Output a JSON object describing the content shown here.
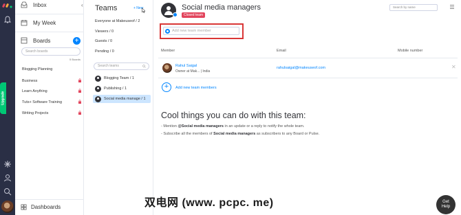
{
  "sidebar": {
    "inbox_label": "Inbox",
    "my_week_label": "My Week",
    "boards_label": "Boards",
    "boards_search_placeholder": "Search boards",
    "boards_count": "5 Boards",
    "boards": [
      {
        "label": "Blogging Planning",
        "locked": false
      },
      {
        "label": "Business",
        "locked": true
      },
      {
        "label": "Learn Anything",
        "locked": true
      },
      {
        "label": "Tuts+ Software Training",
        "locked": true
      },
      {
        "label": "Writing Projects",
        "locked": true
      }
    ],
    "dashboards_label": "Dashboards",
    "upgrade_label": "Upgrade"
  },
  "teams": {
    "title": "Teams",
    "new_label": "+ New",
    "filters": [
      {
        "label": "Everyone at Makeuseof / 2"
      },
      {
        "label": "Viewers / 0"
      },
      {
        "label": "Guests / 0"
      },
      {
        "label": "Pending / 0"
      }
    ],
    "search_placeholder": "Search teams",
    "items": [
      {
        "label": "Blogging Team / 1",
        "active": false
      },
      {
        "label": "Publishing / 1",
        "active": false
      },
      {
        "label": "Social media manage / 1",
        "active": true
      }
    ]
  },
  "main": {
    "team_name": "Social media managers",
    "closed_badge": "Closed team",
    "search_placeholder": "Search by name",
    "add_member_placeholder": "Add new team member",
    "columns": {
      "member": "Member",
      "email": "Email",
      "mobile": "Mobile number"
    },
    "members": [
      {
        "name": "Rahul Saigal",
        "title": "Owner at Mak...",
        "location": "| India",
        "email": "rahulsaigal@makeuseof.com"
      }
    ],
    "add_team_members_label": "Add new team members",
    "cool_title": "Cool things you can do with this team:",
    "tips": [
      {
        "prefix": "- Mention ",
        "bold": "@Social media managers",
        "suffix": " in an update or a reply to notify the whole team."
      },
      {
        "prefix": "- Subscribe all the members of ",
        "bold": "Social media managers",
        "suffix": " as subscribers to any Board or Pulse."
      }
    ]
  },
  "help": {
    "line1": "Get",
    "line2": "Help"
  },
  "watermark": "双电网 (www. pcpc. me)",
  "colors": {
    "accent": "#0085ff",
    "rail": "#2a2f45",
    "closed": "#e2445c",
    "upgrade": "#00c875",
    "highlight": "#d93636"
  }
}
